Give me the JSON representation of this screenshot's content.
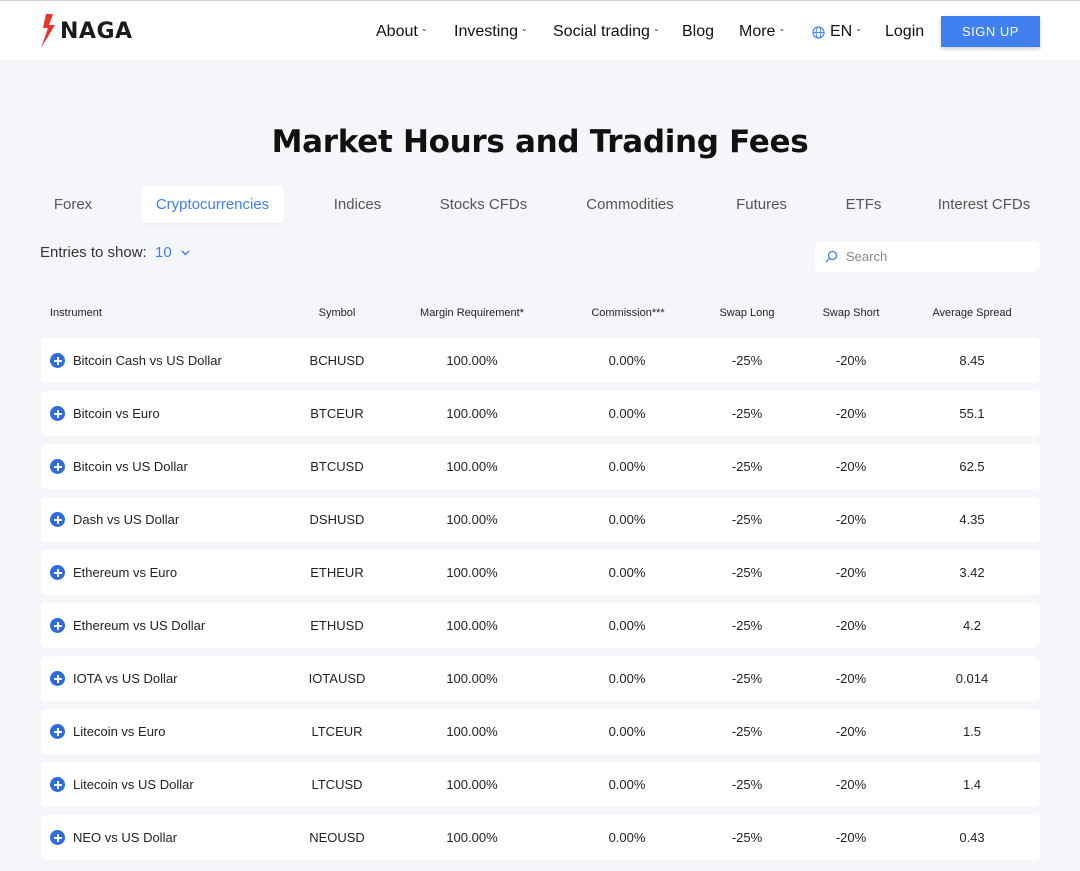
{
  "header": {
    "logo_text": "NAGA",
    "nav": [
      "About",
      "Investing",
      "Social trading",
      "Blog",
      "More",
      "EN",
      "Login"
    ],
    "signup_label": "SIGN UP",
    "accent_color": "#3f7ff0"
  },
  "page_title": "Market Hours and Trading Fees",
  "tabs": [
    "Forex",
    "Cryptocurrencies",
    "Indices",
    "Stocks CFDs",
    "Commodities",
    "Futures",
    "ETFs",
    "Interest CFDs"
  ],
  "active_tab": "Cryptocurrencies",
  "controls": {
    "entries_label": "Entries to show:",
    "entries_value": "10",
    "search_placeholder": "Search"
  },
  "table": {
    "columns": [
      "Instrument",
      "Symbol",
      "Margin Requirement*",
      "Commission***",
      "Swap Long",
      "Swap Short",
      "Average Spread"
    ],
    "rows": [
      [
        "Bitcoin Cash vs US Dollar",
        "BCHUSD",
        "100.00%",
        "0.00%",
        "-25%",
        "-20%",
        "8.45"
      ],
      [
        "Bitcoin vs Euro",
        "BTCEUR",
        "100.00%",
        "0.00%",
        "-25%",
        "-20%",
        "55.1"
      ],
      [
        "Bitcoin vs US Dollar",
        "BTCUSD",
        "100.00%",
        "0.00%",
        "-25%",
        "-20%",
        "62.5"
      ],
      [
        "Dash vs US Dollar",
        "DSHUSD",
        "100.00%",
        "0.00%",
        "-25%",
        "-20%",
        "4.35"
      ],
      [
        "Ethereum vs Euro",
        "ETHEUR",
        "100.00%",
        "0.00%",
        "-25%",
        "-20%",
        "3.42"
      ],
      [
        "Ethereum vs US Dollar",
        "ETHUSD",
        "100.00%",
        "0.00%",
        "-25%",
        "-20%",
        "4.2"
      ],
      [
        "IOTA vs US Dollar",
        "IOTAUSD",
        "100.00%",
        "0.00%",
        "-25%",
        "-20%",
        "0.014"
      ],
      [
        "Litecoin vs Euro",
        "LTCEUR",
        "100.00%",
        "0.00%",
        "-25%",
        "-20%",
        "1.5"
      ],
      [
        "Litecoin vs US Dollar",
        "LTCUSD",
        "100.00%",
        "0.00%",
        "-25%",
        "-20%",
        "1.4"
      ],
      [
        "NEO vs US Dollar",
        "NEOUSD",
        "100.00%",
        "0.00%",
        "-25%",
        "-20%",
        "0.43"
      ]
    ]
  }
}
